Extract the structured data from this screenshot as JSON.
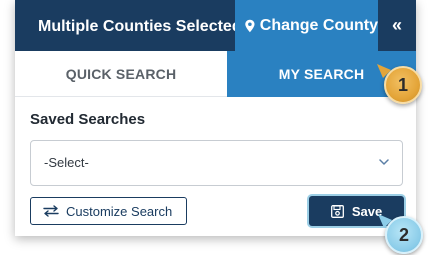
{
  "header": {
    "title": "Multiple Counties Selected",
    "change_county_label": "Change County",
    "collapse_glyph": "«",
    "colors": {
      "navy": "#1a3c60",
      "blue": "#2a81c1"
    },
    "icons": {
      "change_county": "map-pin-icon",
      "collapse": "double-chevron-left-icon"
    }
  },
  "tabs": [
    {
      "label": "QUICK SEARCH",
      "active": false
    },
    {
      "label": "MY SEARCH",
      "active": true
    }
  ],
  "saved_searches": {
    "label": "Saved Searches",
    "select_value": "-Select-",
    "select_icon": "chevron-down-icon"
  },
  "buttons": {
    "customize_label": "Customize Search",
    "customize_icon": "swap-arrows-icon",
    "save_label": "Save",
    "save_icon": "floppy-disk-icon"
  },
  "callouts": [
    {
      "number": "1",
      "color": "#e4a539"
    },
    {
      "number": "2",
      "color": "#8ccde9"
    }
  ]
}
